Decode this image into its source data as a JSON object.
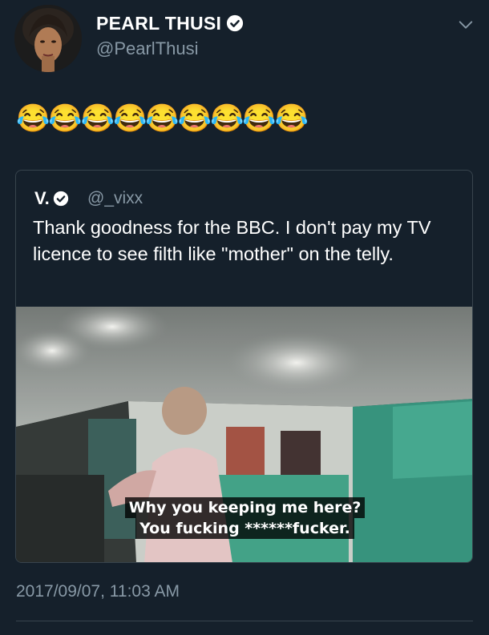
{
  "author": {
    "name": "PEARL THUSI",
    "handle": "@PearlThusi"
  },
  "tweet": {
    "text": "😂😂😂😂😂😂😂😂😂",
    "timestamp": "2017/09/07, 11:03 AM"
  },
  "quoted_tweet": {
    "name": "V.",
    "handle": "@_vixx",
    "text": "Thank goodness for the BBC. I don't pay my TV licence to see filth like \"mother\" on the telly.",
    "media": {
      "subtitle_line1": "Why you keeping me here?",
      "subtitle_line2": "You fucking ******fucker."
    }
  },
  "colors": {
    "background": "#15202b",
    "secondary_text": "#8899a6",
    "border": "#38444d"
  }
}
